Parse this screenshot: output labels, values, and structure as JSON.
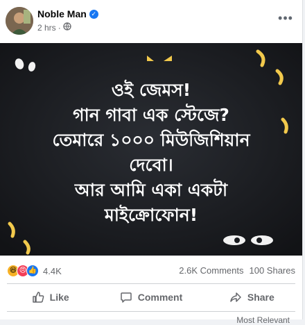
{
  "post": {
    "author": "Noble Man",
    "time": "2 hrs",
    "privacy_icon": "globe-icon",
    "verified_icon": "verified-badge-icon",
    "more_icon": "more-options-icon",
    "meme_lines": [
      "ওই জেমস!",
      "গান গাবা এক স্টেজে?",
      "তেমারে ১০০০ মিউজিশিয়ান",
      "দেবো।",
      "আর আমি একা একটা",
      "মাইক্রোফোন!"
    ]
  },
  "stats": {
    "reactions": [
      "haha-icon",
      "angry-icon",
      "like-icon"
    ],
    "reaction_count": "4.4K",
    "comments": "2.6K Comments",
    "shares": "100 Shares"
  },
  "actions": {
    "like": "Like",
    "comment": "Comment",
    "share": "Share"
  },
  "footer": {
    "partial_text": "Most Relevant"
  },
  "colors": {
    "accent": "#1877f2",
    "image_bg": "#1a1c20",
    "eye": "#f2c94c"
  }
}
